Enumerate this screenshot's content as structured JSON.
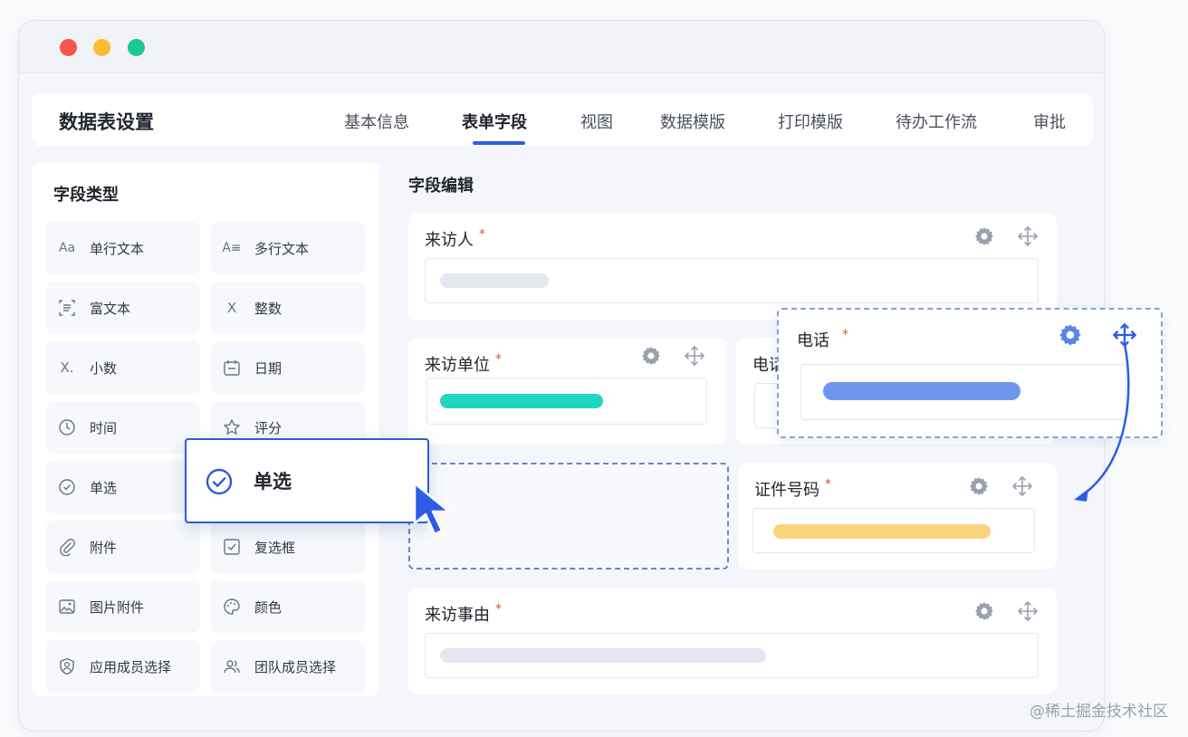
{
  "window": {
    "controls": [
      "close",
      "minimize",
      "maximize"
    ]
  },
  "header": {
    "title": "数据表设置",
    "tabs": [
      "基本信息",
      "表单字段",
      "视图",
      "数据模版",
      "打印模版",
      "待办工作流",
      "审批"
    ],
    "active_tab": "表单字段"
  },
  "sidebar": {
    "title": "字段类型",
    "items": [
      {
        "icon": "Aa",
        "label": "单行文本"
      },
      {
        "icon": "A≡",
        "label": "多行文本"
      },
      {
        "icon": "[≡]",
        "label": "富文本"
      },
      {
        "icon": "X",
        "label": "整数"
      },
      {
        "icon": "X.",
        "label": "小数"
      },
      {
        "icon": "calendar",
        "label": "日期"
      },
      {
        "icon": "clock",
        "label": "时间"
      },
      {
        "icon": "star",
        "label": "评分"
      },
      {
        "icon": "check-circle",
        "label": "单选"
      },
      {
        "icon": "check-box",
        "label": "复选框"
      },
      {
        "icon": "paperclip",
        "label": "附件"
      },
      {
        "icon": "palette",
        "label": "颜色"
      },
      {
        "icon": "image",
        "label": "图片附件"
      },
      {
        "icon": "team",
        "label": "团队成员选择"
      },
      {
        "icon": "user-badge",
        "label": "应用成员选择"
      }
    ]
  },
  "editor": {
    "title": "字段编辑",
    "fields": {
      "visitor": {
        "label": "来访人",
        "required_mark": "*"
      },
      "unit": {
        "label": "来访单位",
        "required_mark": "*"
      },
      "phone_partial": {
        "label": "电话"
      },
      "id_number": {
        "label": "证件号码",
        "required_mark": "*"
      },
      "reason": {
        "label": "来访事由",
        "required_mark": "*"
      }
    }
  },
  "drag_preview_phone": {
    "label": "电话",
    "required_mark": "*"
  },
  "drag_preview_single": {
    "label": "单选"
  },
  "colors": {
    "accent": "#2d5ce6",
    "teal": "#21d6bf",
    "blue_pill": "#6f96ef",
    "yellow_pill": "#fad47a",
    "gray_pill": "#e4e7ee"
  },
  "watermark": "@稀土掘金技术社区"
}
